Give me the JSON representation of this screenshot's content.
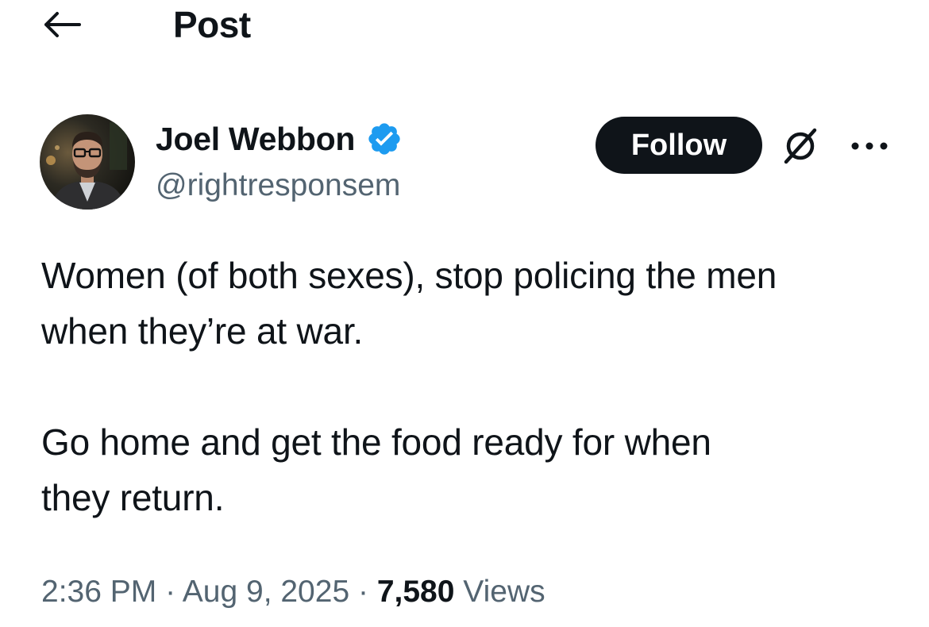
{
  "header": {
    "back_icon": "arrow-left-icon",
    "title": "Post"
  },
  "author": {
    "display_name": "Joel Webbon",
    "handle": "@rightresponsem",
    "verified": true,
    "verified_color": "#1d9bf0",
    "avatar_icon": "avatar-photo"
  },
  "actions": {
    "follow_label": "Follow",
    "grok_icon": "grok-icon",
    "more_icon": "more-horizontal-icon"
  },
  "post": {
    "text": "Women (of both sexes), stop policing the men\nwhen they’re at war.\n\nGo home and get the food ready for when\nthey return."
  },
  "meta": {
    "time": "2:36 PM",
    "separator": "·",
    "date": "Aug 9, 2025",
    "views_count": "7,580",
    "views_label": "Views"
  },
  "colors": {
    "text_primary": "#0f1419",
    "text_secondary": "#536471",
    "follow_bg": "#0f1419",
    "background": "#ffffff"
  }
}
